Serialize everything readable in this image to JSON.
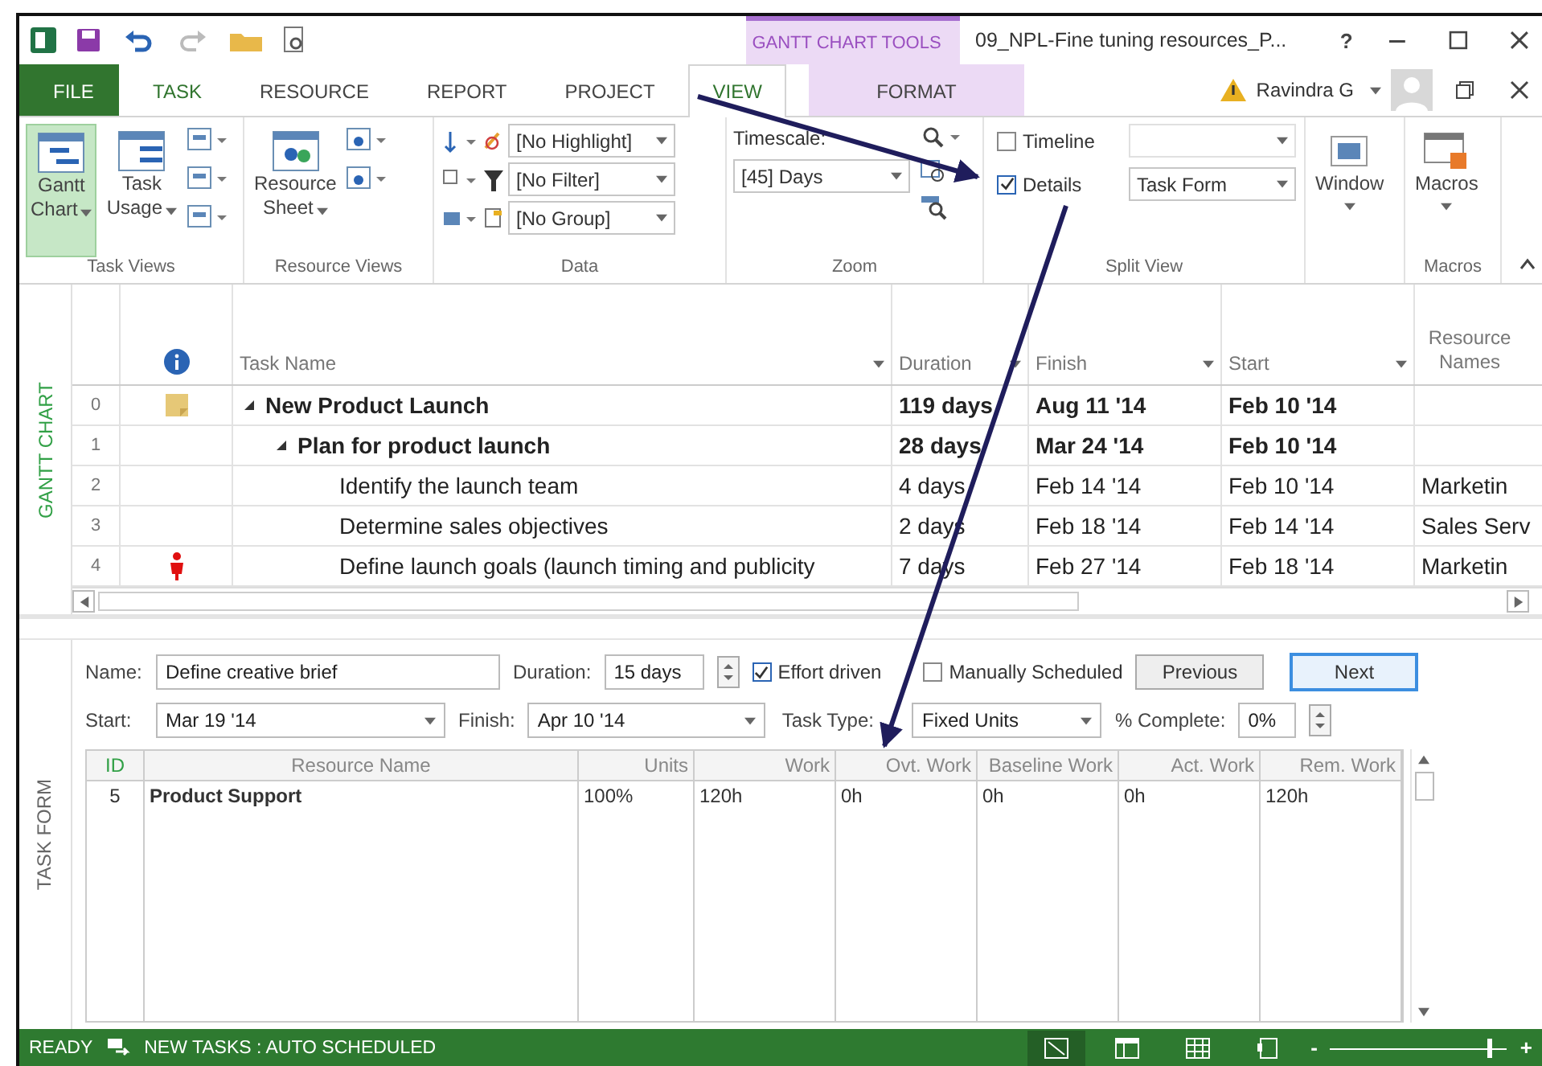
{
  "title_bar": {
    "title": "09_NPL-Fine tuning resources_P...",
    "help": "?"
  },
  "contextual_group": "GANTT CHART TOOLS",
  "tabs": [
    {
      "label": "FILE",
      "kind": "file",
      "selected": false
    },
    {
      "label": "TASK",
      "kind": "normal",
      "selected": false
    },
    {
      "label": "RESOURCE",
      "kind": "normal",
      "selected": false
    },
    {
      "label": "REPORT",
      "kind": "normal",
      "selected": false
    },
    {
      "label": "PROJECT",
      "kind": "normal",
      "selected": false
    },
    {
      "label": "VIEW",
      "kind": "normal",
      "selected": true
    },
    {
      "label": "FORMAT",
      "kind": "contextual",
      "selected": false
    }
  ],
  "user": {
    "name": "Ravindra G"
  },
  "ribbon": {
    "task_views": {
      "label": "Task Views",
      "gantt": {
        "line1": "Gantt",
        "line2": "Chart",
        "selected": true
      },
      "usage": {
        "line1": "Task",
        "line2": "Usage",
        "selected": false
      }
    },
    "resource_views": {
      "label": "Resource Views",
      "sheet": {
        "line1": "Resource",
        "line2": "Sheet"
      }
    },
    "data": {
      "label": "Data",
      "highlight": "[No Highlight]",
      "filter": "[No Filter]",
      "group": "[No Group]"
    },
    "zoom": {
      "label": "Zoom",
      "timescale_label": "Timescale:",
      "timescale": "[45] Days"
    },
    "split_view": {
      "label": "Split View",
      "timeline": {
        "label": "Timeline",
        "checked": false
      },
      "details": {
        "label": "Details",
        "checked": true
      },
      "details_view": "Task Form"
    },
    "window": {
      "label": "Window"
    },
    "macros": {
      "label": "Macros",
      "group_label": "Macros"
    }
  },
  "gantt": {
    "side_label": "GANTT CHART",
    "columns": [
      "Task Name",
      "Duration",
      "Finish",
      "Start",
      "Resource Names"
    ],
    "rows": [
      {
        "id": "0",
        "kind": "note",
        "name": "New Product Launch",
        "summary": true,
        "expanded": true,
        "duration": "119 days",
        "finish": "Aug 11 '14",
        "start": "Feb 10 '14",
        "children": [
          {
            "id": "1",
            "name": "Plan for product launch",
            "summary": true,
            "expanded": true,
            "duration": "28 days",
            "finish": "Mar 24 '14",
            "start": "Feb 10 '14",
            "children": [
              {
                "id": "2",
                "name": "Identify the launch team",
                "summary": false,
                "duration": "4 days",
                "finish": "Feb 14 '14",
                "start": "Feb 10 '14",
                "resources": "Marketin"
              },
              {
                "id": "3",
                "name": "Determine sales objectives",
                "summary": false,
                "duration": "2 days",
                "finish": "Feb 18 '14",
                "start": "Feb 14 '14",
                "resources": "Sales Serv"
              },
              {
                "id": "4",
                "kind": "person",
                "name": "Define launch goals (launch timing and publicity",
                "summary": false,
                "duration": "7 days",
                "finish": "Feb 27 '14",
                "start": "Feb 18 '14",
                "resources": "Marketin"
              }
            ]
          }
        ]
      }
    ]
  },
  "task_form": {
    "side_label": "TASK FORM",
    "name_label": "Name:",
    "name": "Define creative brief",
    "duration_label": "Duration:",
    "duration": "15 days",
    "effort_driven": {
      "label": "Effort driven",
      "checked": true
    },
    "manually_scheduled": {
      "label": "Manually Scheduled",
      "checked": false
    },
    "buttons": [
      {
        "label": "Previous",
        "kind": "normal"
      },
      {
        "label": "Next",
        "kind": "default"
      }
    ],
    "start_label": "Start:",
    "start": "Mar 19 '14",
    "finish_label": "Finish:",
    "finish": "Apr 10 '14",
    "task_type_label": "Task Type:",
    "task_type": "Fixed Units",
    "complete_label": "% Complete:",
    "complete": "0%",
    "columns": [
      "ID",
      "Resource Name",
      "Units",
      "Work",
      "Ovt. Work",
      "Baseline Work",
      "Act. Work",
      "Rem. Work"
    ],
    "rows": [
      [
        "5",
        "Product Support",
        "100%",
        "120h",
        "0h",
        "0h",
        "0h",
        "120h"
      ]
    ]
  },
  "status_bar": {
    "ready": "READY",
    "new_tasks": "NEW TASKS : AUTO SCHEDULED",
    "zoom_out": "-",
    "zoom_in": "+",
    "zoom_level": {
      "level": 0.9
    }
  }
}
